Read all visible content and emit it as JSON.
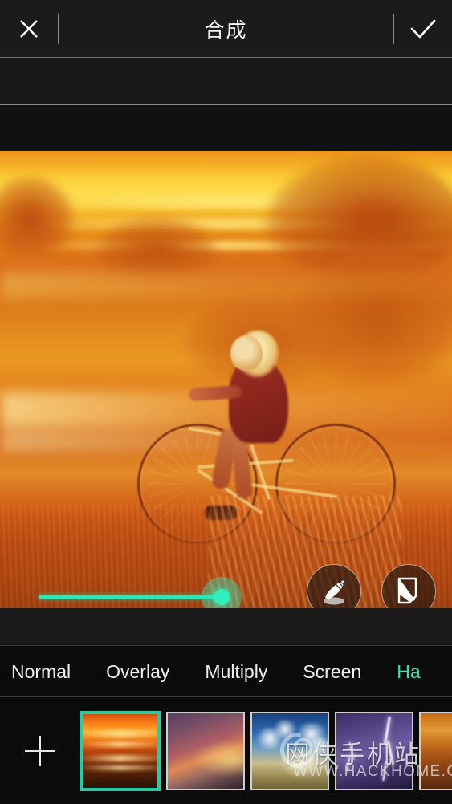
{
  "header": {
    "title": "合成",
    "close_icon": "close-x-icon",
    "confirm_icon": "check-icon"
  },
  "canvas": {
    "description": "Orange double-exposure photo of a blonde woman riding a bicycle through a sunlit field",
    "overlay_accent": "#35e3b4"
  },
  "opacity_slider": {
    "fill_color": "#35e3b4",
    "value_percent": 67
  },
  "tools": [
    {
      "name": "brush-tool",
      "icon": "paintbrush-icon"
    },
    {
      "name": "mask-tool",
      "icon": "page-curl-icon"
    }
  ],
  "blend_modes": {
    "selected": "Ha",
    "items": [
      {
        "label": "Normal",
        "active": false
      },
      {
        "label": "Overlay",
        "active": false
      },
      {
        "label": "Multiply",
        "active": false
      },
      {
        "label": "Screen",
        "active": false
      },
      {
        "label": "Ha",
        "active": true
      }
    ]
  },
  "thumbnails": {
    "add_label": "+",
    "items": [
      {
        "name": "orange-sunset",
        "selected": true
      },
      {
        "name": "purple-dusk",
        "selected": false
      },
      {
        "name": "blue-sky-clouds",
        "selected": false
      },
      {
        "name": "purple-lightning",
        "selected": false
      },
      {
        "name": "amber-clouds",
        "selected": false
      }
    ],
    "selected_border_color": "#2bc9a2"
  },
  "watermark": {
    "site_name": "网侠手机站",
    "url": "WWW.HACKHOME.COM"
  }
}
